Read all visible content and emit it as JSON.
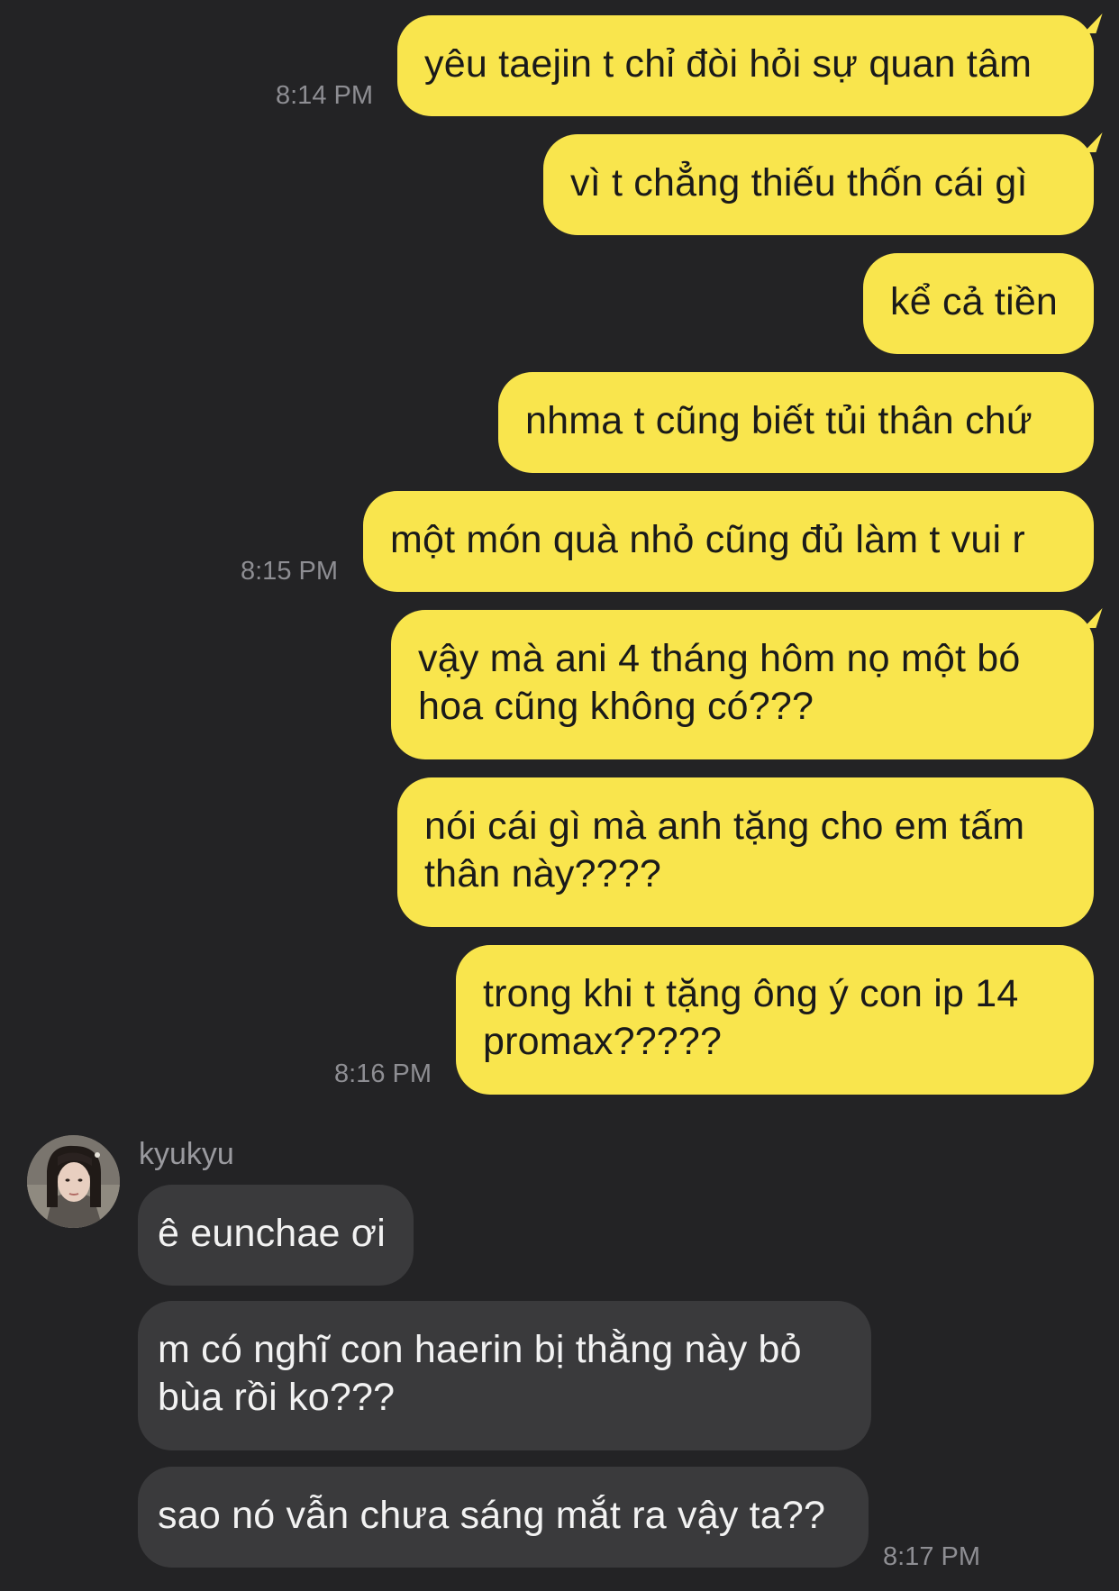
{
  "chat": {
    "outgoing": [
      {
        "text": "yêu taejin t chỉ đòi hỏi sự quan tâm"
      },
      {
        "text": "vì t chẳng thiếu thốn cái gì"
      },
      {
        "text": "kể cả tiền"
      },
      {
        "text": "nhma t cũng biết tủi thân chứ"
      },
      {
        "text": "một món quà nhỏ cũng đủ làm t vui r"
      },
      {
        "lines": [
          "vậy mà ani 4 tháng hôm nọ một bó",
          "hoa cũng không có???"
        ]
      },
      {
        "lines": [
          "nói cái gì mà anh tặng cho em tấm",
          "thân này????"
        ]
      },
      {
        "lines": [
          "trong khi t tặng ông ý con ip 14",
          "promax?????"
        ]
      }
    ],
    "incoming": [
      {
        "text": "ê eunchae ơi"
      },
      {
        "lines": [
          "m có nghĩ con haerin bị thằng này bỏ",
          "bùa rồi ko???"
        ]
      },
      {
        "text": "sao nó vẫn chưa sáng mắt ra vậy ta??"
      }
    ],
    "sender_name": "kyukyu",
    "timestamps": [
      "8:14 PM",
      "8:15 PM",
      "8:16 PM",
      "8:17 PM"
    ]
  },
  "colors": {
    "background": "#232325",
    "outgoing_bubble": "#f9e54d",
    "incoming_bubble": "#3a3a3c",
    "timestamp": "#8e8e93"
  }
}
